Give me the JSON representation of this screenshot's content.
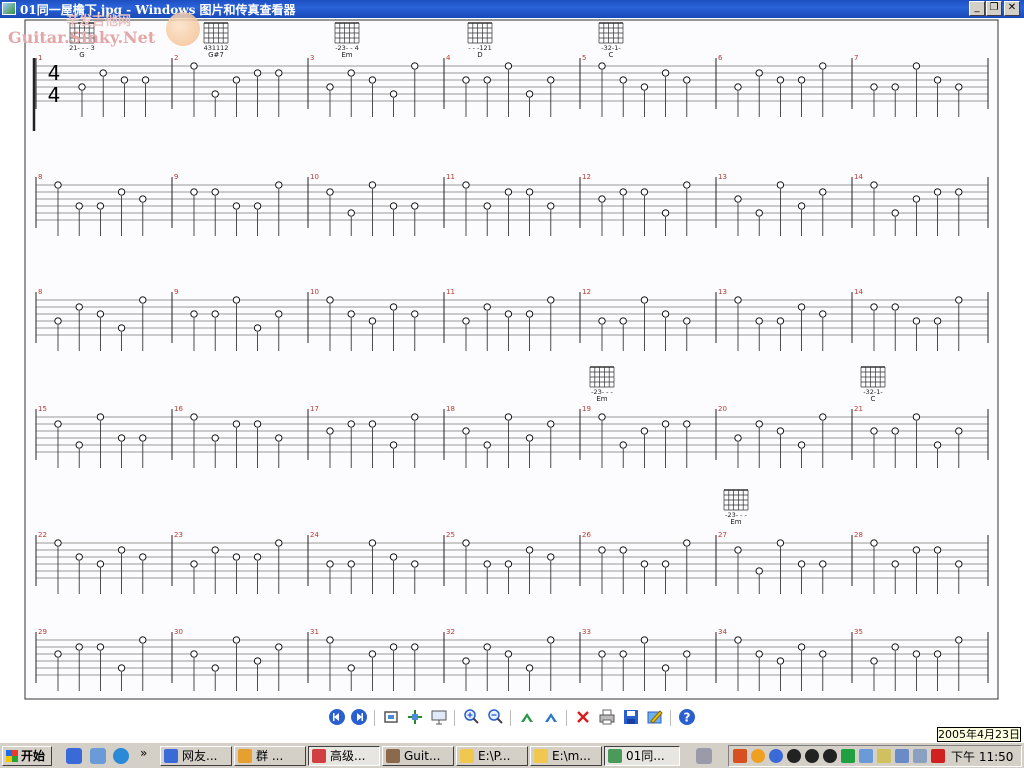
{
  "window": {
    "title": "01同一屋檐下.jpg - Windows 图片和传真查看器",
    "buttons": {
      "minimize": "_",
      "restore": "❐",
      "close": "✕"
    }
  },
  "watermark": {
    "site": "Guitar.Sinky.Net",
    "cn": "辛发吉他网"
  },
  "tab": {
    "time_signature": {
      "top": "4",
      "bottom": "4"
    },
    "chords": [
      {
        "name": "G",
        "fingering": "21- - - 3"
      },
      {
        "name": "G#7",
        "fingering": "431112"
      },
      {
        "name": "Em",
        "fingering": "-23- - 4"
      },
      {
        "name": "D",
        "fingering": "- - -121"
      },
      {
        "name": "C",
        "fingering": "-32-1-"
      },
      {
        "name": "Em",
        "fingering": "-23- - -"
      },
      {
        "name": "C",
        "fingering": "-32-1-"
      },
      {
        "name": "Em",
        "fingering": "-23- - -"
      }
    ],
    "rows": [
      {
        "measures": [
          "1",
          "2",
          "3",
          "4",
          "5",
          "6",
          "7"
        ]
      },
      {
        "measures": [
          "8",
          "9",
          "10",
          "11",
          "12",
          "13",
          "14"
        ]
      },
      {
        "measures": [
          "8",
          "9",
          "10",
          "11",
          "12",
          "13",
          "14"
        ]
      },
      {
        "measures": [
          "15",
          "16",
          "17",
          "18",
          "19",
          "20",
          "21"
        ]
      },
      {
        "measures": [
          "22",
          "23",
          "24",
          "25",
          "26",
          "27",
          "28"
        ]
      },
      {
        "measures": [
          "29",
          "30",
          "31",
          "32",
          "33",
          "34",
          "35"
        ]
      }
    ]
  },
  "toolbar": {
    "buttons": [
      "previous-image",
      "next-image",
      "best-fit",
      "actual-size",
      "slideshow",
      "zoom-in",
      "zoom-out",
      "rotate-clockwise",
      "rotate-counterclockwise",
      "delete",
      "print",
      "save",
      "edit",
      "help"
    ]
  },
  "date_tooltip": "2005年4月23日",
  "taskbar": {
    "start_label": "开始",
    "tasks": [
      {
        "label": "网友..."
      },
      {
        "label": "群 ..."
      },
      {
        "label": "高级..."
      },
      {
        "label": "Guit..."
      },
      {
        "label": "E:\\P..."
      },
      {
        "label": "E:\\m..."
      },
      {
        "label": "01同..."
      }
    ],
    "quick_launch_more": "»",
    "clock": "下午 11:50"
  },
  "colors": {
    "titlebar": "#2a63d8",
    "taskbar": "#d4d0c8",
    "measure_number": "#c0392b"
  }
}
